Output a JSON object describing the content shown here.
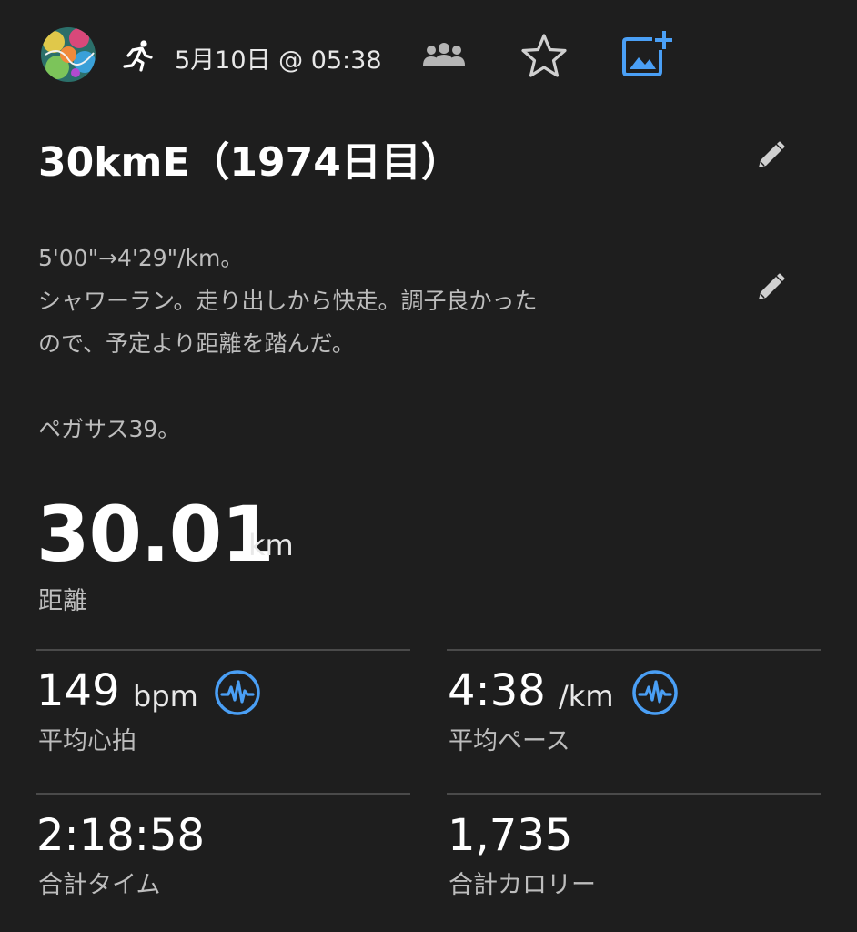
{
  "header": {
    "activity_icon": "running-person-icon",
    "datetime": "5月10日 @ 05:38",
    "icons": [
      "group-icon",
      "star-icon",
      "add-photo-icon"
    ],
    "accent_color": "#4a9ff5"
  },
  "activity": {
    "title": "30kmE（1974日目）",
    "description": "5'00\"→4'29\"/km。\nシャワーラン。走り出しから快走。調子良かった\nので、予定より距離を踏んだ。\n\nペガサス39。"
  },
  "distance": {
    "value": "30.01",
    "unit": "km",
    "label": "距離"
  },
  "stats": {
    "heart_rate": {
      "value": "149",
      "unit": "bpm",
      "label": "平均心拍",
      "icon": "pulse-chart-icon"
    },
    "pace": {
      "value": "4:38",
      "unit": "/km",
      "label": "平均ペース",
      "icon": "pulse-chart-icon"
    },
    "time": {
      "value": "2:18:58",
      "label": "合計タイム"
    },
    "calories": {
      "value": "1,735",
      "label": "合計カロリー"
    }
  }
}
